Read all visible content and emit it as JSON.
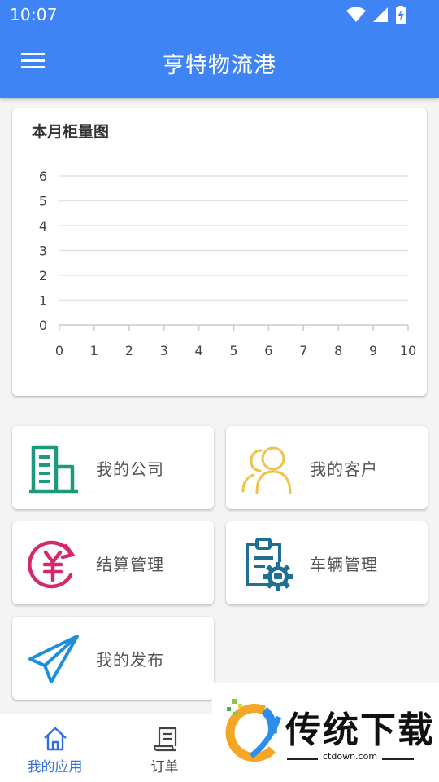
{
  "status_bar": {
    "time": "10:07"
  },
  "app_bar": {
    "title": "亨特物流港"
  },
  "chart_card": {
    "title": "本月柜量图"
  },
  "chart_data": {
    "type": "line",
    "title": "本月柜量图",
    "x_ticks": [
      0,
      1,
      2,
      3,
      4,
      5,
      6,
      7,
      8,
      9,
      10
    ],
    "y_ticks": [
      0,
      1,
      2,
      3,
      4,
      5,
      6
    ],
    "xlim": [
      0,
      10
    ],
    "ylim": [
      0,
      6
    ],
    "grid": true,
    "series": []
  },
  "menu": [
    {
      "label": "我的公司",
      "icon": "company-building-icon",
      "color": "#1b9a7e"
    },
    {
      "label": "我的客户",
      "icon": "customers-icon",
      "color": "#f0c14b"
    },
    {
      "label": "结算管理",
      "icon": "settlement-yen-icon",
      "color": "#d4286f"
    },
    {
      "label": "车辆管理",
      "icon": "vehicle-clipboard-icon",
      "color": "#1d6f93"
    },
    {
      "label": "我的发布",
      "icon": "paper-plane-icon",
      "color": "#1f8fd9"
    }
  ],
  "bottom_nav": [
    {
      "label": "我的应用",
      "icon": "home-icon",
      "active": true
    },
    {
      "label": "订单",
      "icon": "orders-icon",
      "active": false
    }
  ],
  "watermark": {
    "text": "传统下载",
    "url": "ctdown.com"
  },
  "colors": {
    "primary": "#3f84f5",
    "nav_active": "#2f6fe0",
    "nav_inactive": "#444444"
  }
}
